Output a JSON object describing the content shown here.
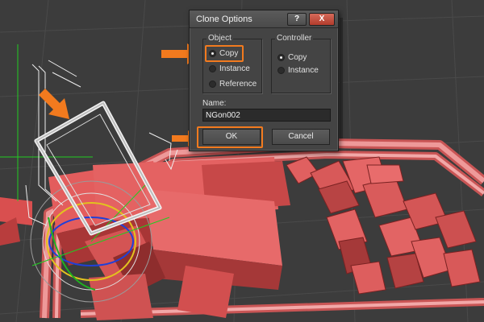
{
  "dialog": {
    "title": "Clone Options",
    "help_glyph": "?",
    "close_glyph": "X",
    "object_group": {
      "label": "Object",
      "options": [
        {
          "label": "Copy",
          "selected": true
        },
        {
          "label": "Instance",
          "selected": false
        },
        {
          "label": "Reference",
          "selected": false
        }
      ]
    },
    "controller_group": {
      "label": "Controller",
      "options": [
        {
          "label": "Copy",
          "selected": true
        },
        {
          "label": "Instance",
          "selected": false
        }
      ]
    },
    "name_label": "Name:",
    "name_value": "NGon002",
    "ok_label": "OK",
    "cancel_label": "Cancel"
  },
  "annotations": {
    "highlight_color": "#f27a1e",
    "arrow_color": "#f27a1e",
    "arrows": [
      "arrow-to-copy-option",
      "arrow-to-ok-button",
      "arrow-to-cloned-frame"
    ]
  },
  "viewport": {
    "background": "#3c3c3c",
    "object_color": "#e05a5a"
  }
}
